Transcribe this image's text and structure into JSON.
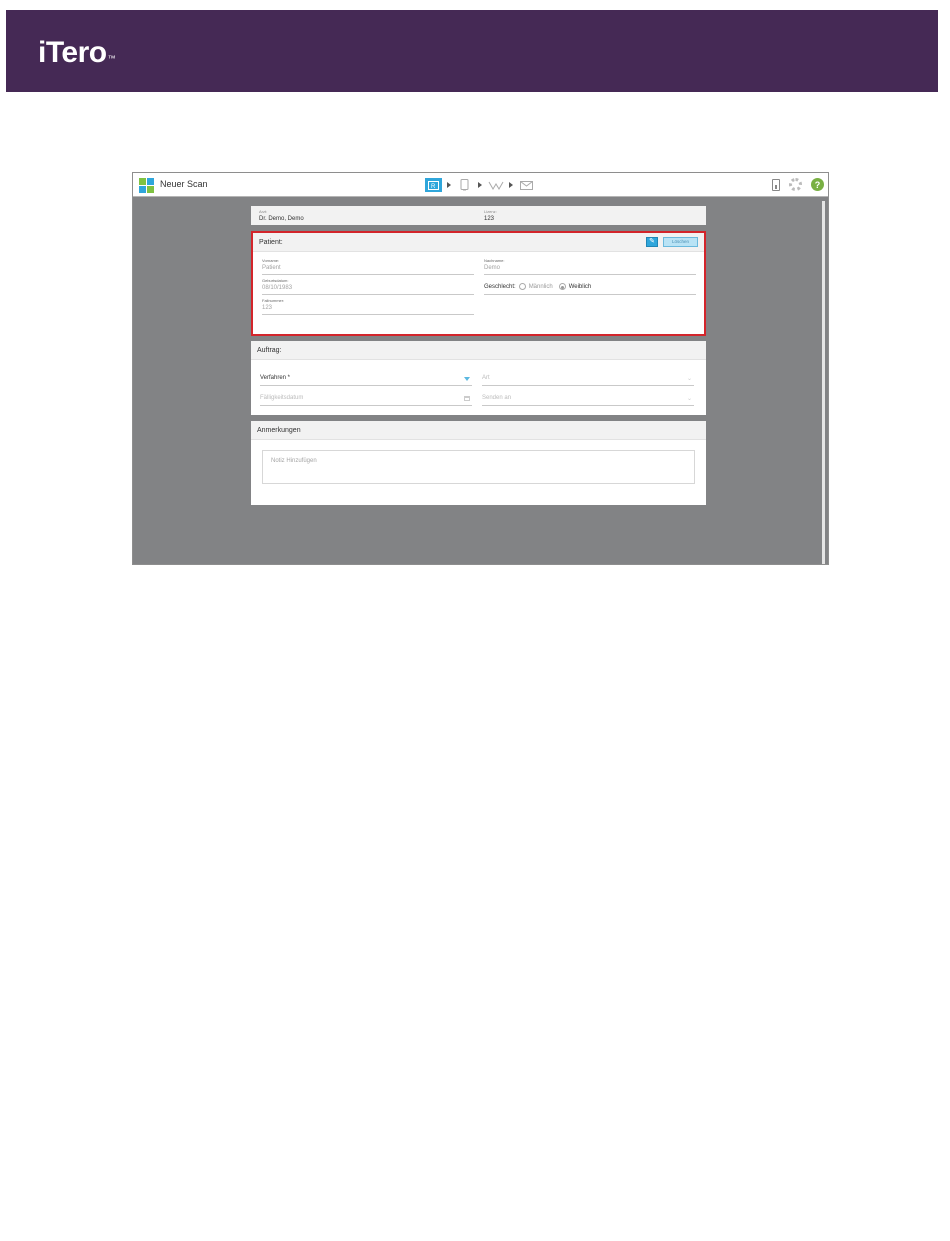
{
  "header": {
    "brand": "iTero",
    "tm": "™"
  },
  "app": {
    "title": "Neuer Scan",
    "icon_colors": [
      "#7fc241",
      "#2fa6db",
      "#2fa6db",
      "#7fc241"
    ],
    "step_icons": [
      "rx-icon",
      "scan-icon",
      "view-icon",
      "send-icon"
    ],
    "accent": "#2fa6db",
    "alert_border": "#d3252b"
  },
  "doctor": {
    "label": "Arzt:",
    "value": "Dr. Demo, Demo"
  },
  "license": {
    "label": "Lizenz:",
    "value": "123"
  },
  "patient": {
    "title": "Patient:",
    "edit_icon": "pencil-icon",
    "delete_label": "Löschen",
    "first_name_label": "Vorname:",
    "first_name": "Patient",
    "last_name_label": "Nachname:",
    "last_name": "Demo",
    "dob_label": "Geburtsdatum:",
    "dob": "08/10/1983",
    "case_label": "Fallnummer:",
    "case": "123",
    "gender_label": "Geschlecht:",
    "male": "Männlich",
    "female": "Weiblich",
    "selected_gender": "Weiblich"
  },
  "order": {
    "title": "Auftrag:",
    "procedure": "Verfahren *",
    "type": "Art",
    "due_date": "Fälligkeitsdatum",
    "send_to": "Senden an"
  },
  "notes": {
    "title": "Anmerkungen",
    "placeholder": "Notiz Hinzufügen"
  }
}
